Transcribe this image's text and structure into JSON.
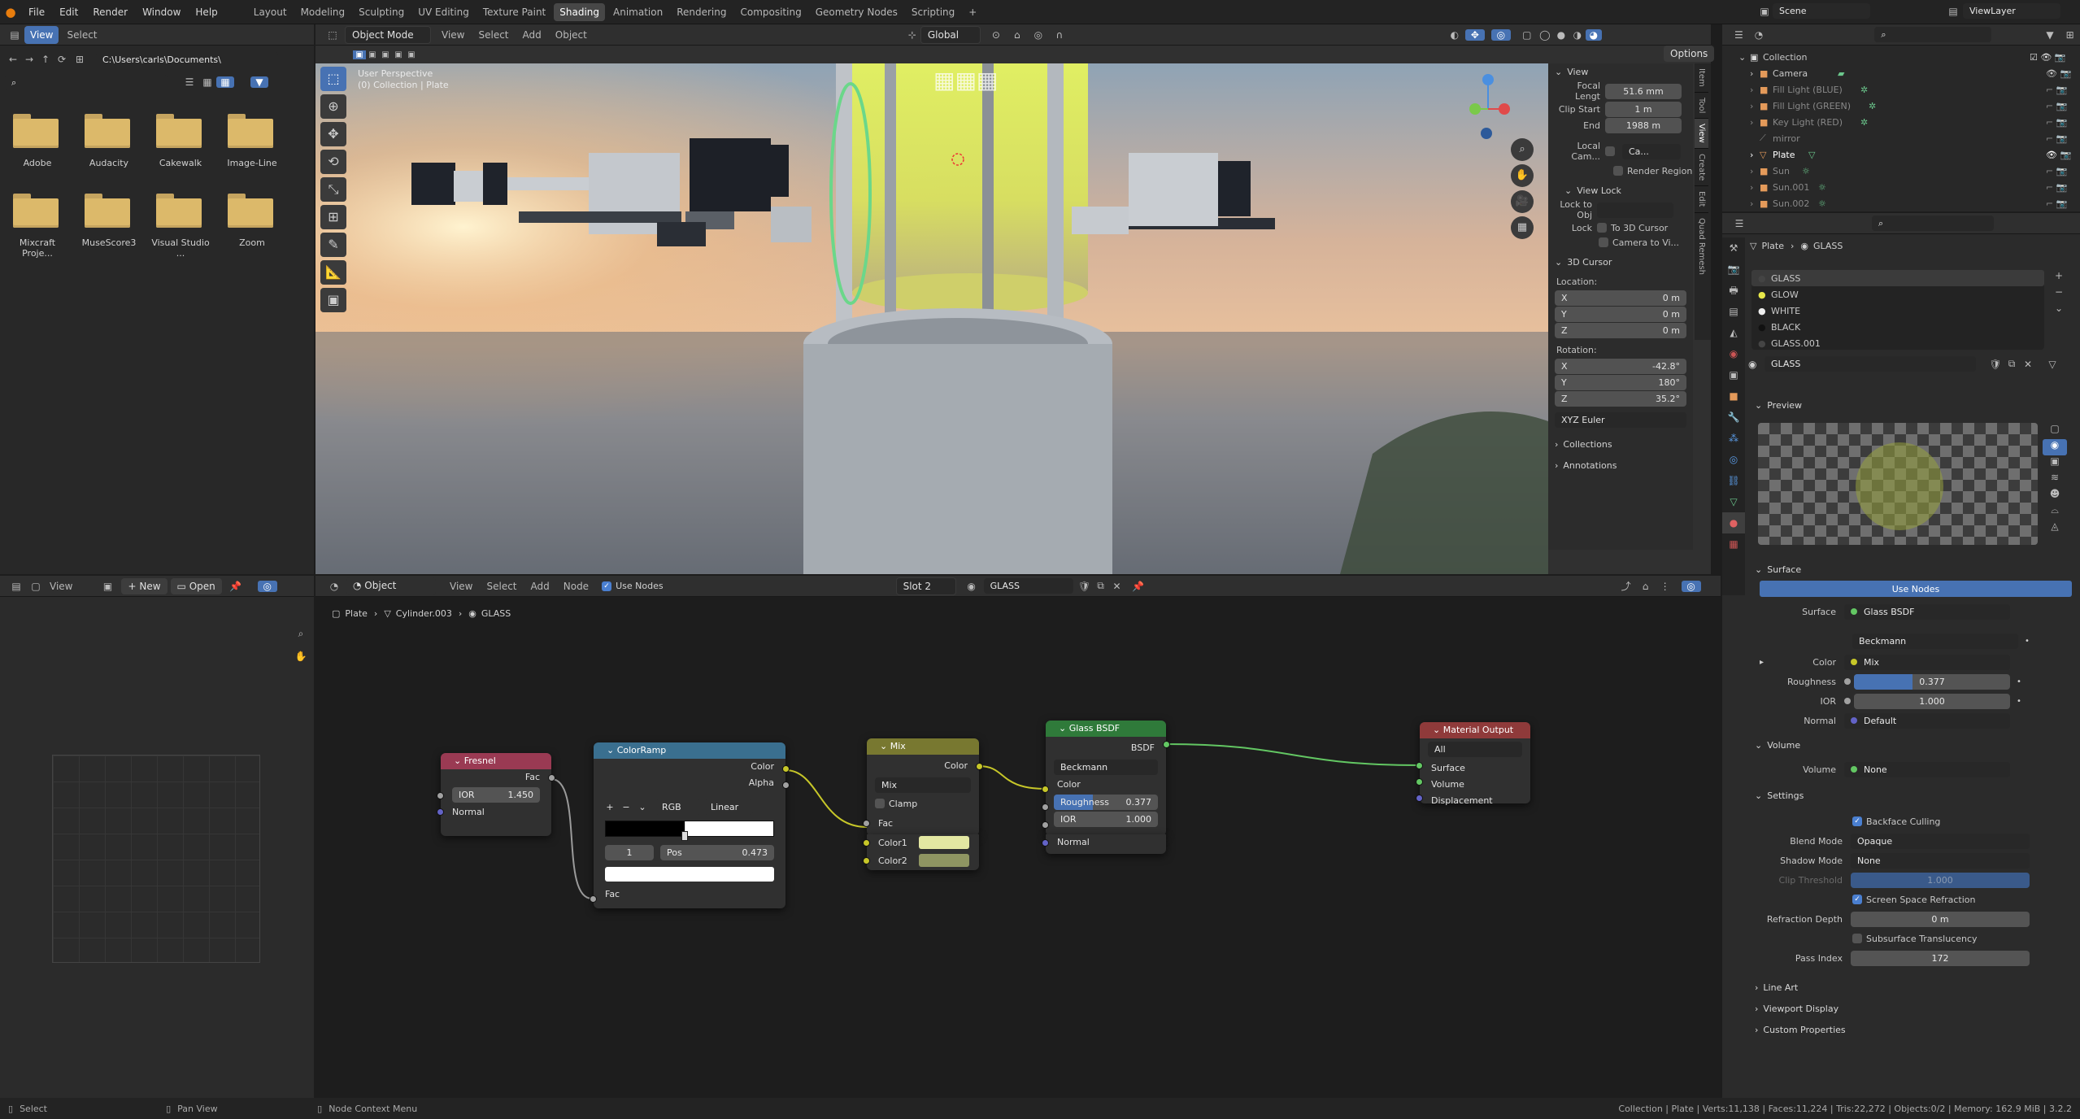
{
  "topbar": {
    "menus": [
      "File",
      "Edit",
      "Render",
      "Window",
      "Help"
    ],
    "workspaces": [
      "Layout",
      "Modeling",
      "Sculpting",
      "UV Editing",
      "Texture Paint",
      "Shading",
      "Animation",
      "Rendering",
      "Compositing",
      "Geometry Nodes",
      "Scripting"
    ],
    "active_workspace": "Shading",
    "add_tab": "+",
    "scene": "Scene",
    "view_layer": "ViewLayer"
  },
  "filebrowser": {
    "view": "View",
    "select": "Select",
    "path": "C:\\Users\\carls\\Documents\\",
    "folders": [
      "Adobe",
      "Audacity",
      "Cakewalk",
      "Image-Line",
      "Mixcraft Proje...",
      "MuseScore3",
      "Visual Studio ...",
      "Zoom"
    ]
  },
  "viewport": {
    "mode": "Object Mode",
    "menu": [
      "View",
      "Select",
      "Add",
      "Object"
    ],
    "orientation": "Global",
    "options": "Options",
    "overlay_title": "User Perspective",
    "overlay_sub": "(0) Collection | Plate",
    "gizmo": {
      "x": "X",
      "y": "Y",
      "z": "Z"
    },
    "tabs": [
      "Item",
      "Tool",
      "View",
      "Create",
      "Edit",
      "Quad Remesh"
    ]
  },
  "npanel": {
    "view_header": "View",
    "focal_label": "Focal Lengt",
    "focal": "51.6 mm",
    "clip_start_label": "Clip Start",
    "clip_start": "1 m",
    "end_label": "End",
    "end": "1988 m",
    "local_cam_label": "Local Cam...",
    "local_cam_value": "Ca...",
    "render_region": "Render Region",
    "view_lock": "View Lock",
    "lock_obj_label": "Lock to Obj",
    "lock_label": "Lock",
    "to_3d_cursor": "To 3D Cursor",
    "camera_to_view": "Camera to Vi...",
    "cursor_header": "3D Cursor",
    "location": "Location:",
    "loc": {
      "x": "0 m",
      "y": "0 m",
      "z": "0 m"
    },
    "rotation": "Rotation:",
    "rot": {
      "x": "-42.8°",
      "y": "180°",
      "z": "35.2°"
    },
    "axis": {
      "x": "X",
      "y": "Y",
      "z": "Z"
    },
    "euler": "XYZ Euler",
    "collections": "Collections",
    "annotations": "Annotations"
  },
  "outliner": {
    "root": "Collection",
    "items": [
      "Camera",
      "Fill Light (BLUE)",
      "Fill Light (GREEN)",
      "Key Light (RED)",
      "mirror",
      "Plate",
      "Sun",
      "Sun.001",
      "Sun.002"
    ]
  },
  "properties": {
    "breadcrumb_obj": "Plate",
    "breadcrumb_mat": "GLASS",
    "materials": [
      "GLASS",
      "GLOW",
      "WHITE",
      "BLACK",
      "GLASS.001"
    ],
    "material_name": "GLASS",
    "preview": "Preview",
    "surface_header": "Surface",
    "use_nodes": "Use Nodes",
    "surface_label": "Surface",
    "surface_value": "Glass BSDF",
    "distribution": "Beckmann",
    "color_label": "Color",
    "color_value": "Mix",
    "roughness_label": "Roughness",
    "roughness": "0.377",
    "roughness_fill": 0.377,
    "ior_label": "IOR",
    "ior": "1.000",
    "normal_label": "Normal",
    "normal_value": "Default",
    "volume_header": "Volume",
    "volume_label": "Volume",
    "volume_value": "None",
    "settings_header": "Settings",
    "backface": "Backface Culling",
    "blend_label": "Blend Mode",
    "blend": "Opaque",
    "shadow_label": "Shadow Mode",
    "shadow": "None",
    "clip_label": "Clip Threshold",
    "clip": "1.000",
    "ssr": "Screen Space Refraction",
    "refr_label": "Refraction Depth",
    "refr": "0 m",
    "sss": "Subsurface Translucency",
    "pass_label": "Pass Index",
    "pass": "172",
    "line_art": "Line Art",
    "viewport_display": "Viewport Display",
    "custom_props": "Custom Properties"
  },
  "imageeditor": {
    "view": "View",
    "new": "New",
    "open": "Open"
  },
  "nodeeditor": {
    "type": "Object",
    "menu": [
      "View",
      "Select",
      "Add",
      "Node"
    ],
    "use_nodes": "Use Nodes",
    "slot": "Slot 2",
    "material": "GLASS",
    "breadcrumb": [
      "Plate",
      "Cylinder.003",
      "GLASS"
    ]
  },
  "nodes": {
    "fresnel": {
      "title": "Fresnel",
      "out": "Fac",
      "ior_label": "IOR",
      "ior": "1.450",
      "normal": "Normal"
    },
    "colorramp": {
      "title": "ColorRamp",
      "out_color": "Color",
      "out_alpha": "Alpha",
      "mode": "RGB",
      "interp": "Linear",
      "index": "1",
      "pos_label": "Pos",
      "pos": "0.473",
      "fac": "Fac",
      "plus": "+",
      "minus": "−",
      "chev": "⌄"
    },
    "mix": {
      "title": "Mix",
      "out": "Color",
      "blend": "Mix",
      "clamp": "Clamp",
      "fac": "Fac",
      "c1": "Color1",
      "c2": "Color2"
    },
    "glass": {
      "title": "Glass BSDF",
      "out": "BSDF",
      "dist": "Beckmann",
      "color": "Color",
      "rough_label": "Roughness",
      "rough": "0.377",
      "ior_label": "IOR",
      "ior": "1.000",
      "normal": "Normal"
    },
    "output": {
      "title": "Material Output",
      "target": "All",
      "surface": "Surface",
      "volume": "Volume",
      "displacement": "Displacement"
    }
  },
  "statusbar": {
    "select": "Select",
    "pan": "Pan View",
    "context": "Node Context Menu",
    "stats": "Collection | Plate | Verts:11,138 | Faces:11,224 | Tris:22,272 | Objects:0/2 | Memory: 162.9 MiB | 3.2.2"
  },
  "colors": {
    "accent": "#4772b3",
    "green_socket": "#63c763",
    "yellow_socket": "#c7c729"
  }
}
